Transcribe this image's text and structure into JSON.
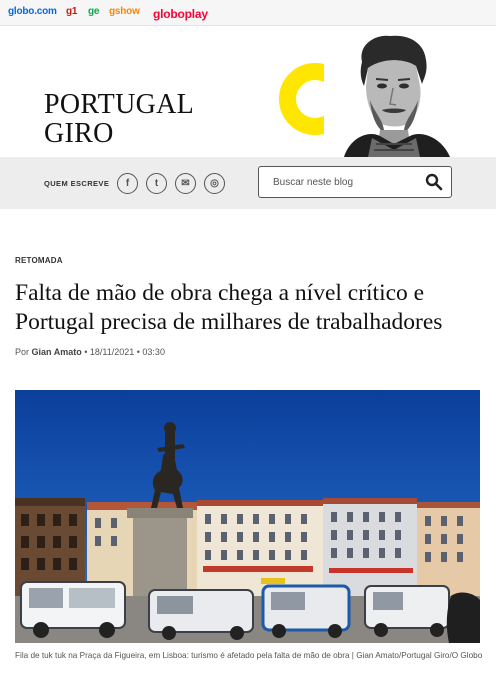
{
  "network": {
    "globo": "globo.com",
    "g1": "g1",
    "ge": "ge",
    "gshow": "gshow",
    "globoplay": "globoplay"
  },
  "blog": {
    "title_line1": "PORTUGAL",
    "title_line2": "GIRO",
    "accent_color": "#ffe600"
  },
  "infobar": {
    "quem_escreve": "QUEM ESCREVE",
    "social": [
      {
        "icon": "facebook-icon",
        "glyph": "f"
      },
      {
        "icon": "twitter-icon",
        "glyph": "t"
      },
      {
        "icon": "email-icon",
        "glyph": "✉"
      },
      {
        "icon": "instagram-icon",
        "glyph": "◎"
      }
    ],
    "search_placeholder": "Buscar neste blog",
    "search_icon": "search-icon"
  },
  "article": {
    "kicker": "RETOMADA",
    "headline": "Falta de mão de obra chega a nível crítico e Portugal precisa de milhares de trabalhadores",
    "byline_prefix": "Por",
    "author": "Gian Amato",
    "date": "18/11/2021",
    "time": "03:30",
    "caption": "Fila de tuk tuk na Praça da Figueira, em Lisboa: turismo é afetado pela falta de mão de obra | Gian Amato/Portugal Giro/O Globo"
  }
}
